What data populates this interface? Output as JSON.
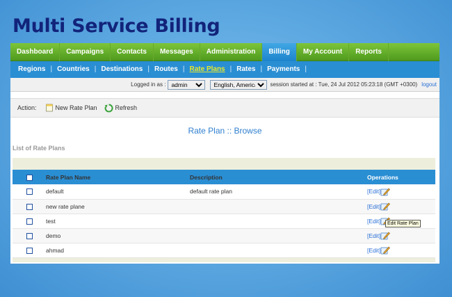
{
  "slide": {
    "title": "Multi Service Billing"
  },
  "main_nav": [
    {
      "label": "Dashboard",
      "active": false
    },
    {
      "label": "Campaigns",
      "active": false
    },
    {
      "label": "Contacts",
      "active": false
    },
    {
      "label": "Messages",
      "active": false
    },
    {
      "label": "Administration",
      "active": false
    },
    {
      "label": "Billing",
      "active": true
    },
    {
      "label": "My Account",
      "active": false
    },
    {
      "label": "Reports",
      "active": false
    }
  ],
  "sub_nav": [
    {
      "label": "Regions",
      "active": false
    },
    {
      "label": "Countries",
      "active": false
    },
    {
      "label": "Destinations",
      "active": false
    },
    {
      "label": "Routes",
      "active": false
    },
    {
      "label": "Rate Plans",
      "active": true
    },
    {
      "label": "Rates",
      "active": false
    },
    {
      "label": "Payments",
      "active": false
    }
  ],
  "session": {
    "logged_in_label": "Logged in as :",
    "user": "admin",
    "language": "English, American",
    "started_text": "session started at : Tue, 24 Jul 2012 05:23:18 (GMT +0300)",
    "logout": "logout"
  },
  "actions": {
    "label": "Action:",
    "new_rate_plan": "New Rate Plan",
    "refresh": "Refresh"
  },
  "page": {
    "heading": "Rate Plan :: Browse",
    "list_title": "List of Rate Plans"
  },
  "table": {
    "headers": {
      "name": "Rate Plan Name",
      "description": "Description",
      "operations": "Operations"
    },
    "edit_label": "[Edit]",
    "tooltip": "Edit Rate Plan",
    "rows": [
      {
        "name": "default",
        "description": "default rate plan"
      },
      {
        "name": "new rate plane",
        "description": ""
      },
      {
        "name": "test",
        "description": ""
      },
      {
        "name": "demo",
        "description": ""
      },
      {
        "name": "ahmad",
        "description": ""
      }
    ]
  }
}
